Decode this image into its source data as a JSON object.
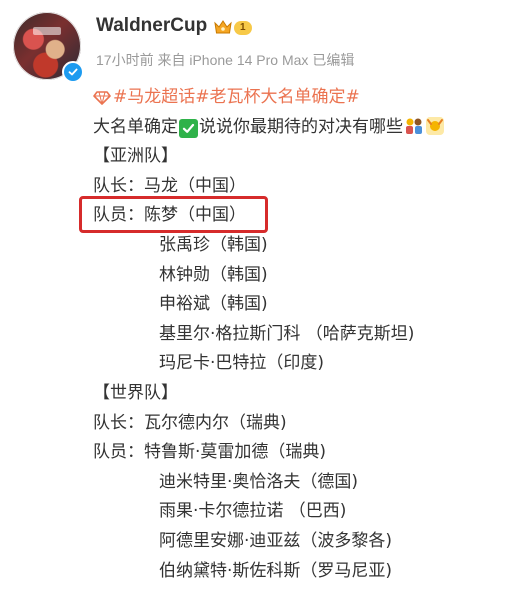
{
  "post": {
    "author": {
      "name": "WaldnerCup",
      "level": "1"
    },
    "meta": {
      "time": "17小时前",
      "source": "来自 iPhone 14 Pro Max",
      "edited": "已编辑"
    },
    "topic": "#马龙超话#老瓦杯大名单确定#",
    "intro_before": "大名单确定",
    "intro_after": "说说你最期待的对决有哪些",
    "lines": [
      {
        "text": "【亚洲队】",
        "kind": "team"
      },
      {
        "text": "队长：马龙（中国）",
        "kind": "row"
      },
      {
        "text": "队员：陈梦（中国）",
        "kind": "row",
        "highlighted": true
      },
      {
        "text": "张禹珍（韩国)",
        "kind": "member"
      },
      {
        "text": "林钟勋（韩国)",
        "kind": "member"
      },
      {
        "text": "申裕斌（韩国)",
        "kind": "member"
      },
      {
        "text": "基里尔·格拉斯门科 （哈萨克斯坦)",
        "kind": "member"
      },
      {
        "text": "玛尼卡·巴特拉（印度)",
        "kind": "member"
      },
      {
        "text": "【世界队】",
        "kind": "team"
      },
      {
        "text": "队长：瓦尔德内尔（瑞典)",
        "kind": "row"
      },
      {
        "text": "队员：特鲁斯·莫雷加德（瑞典)",
        "kind": "row"
      },
      {
        "text": "迪米特里·奥恰洛夫（德国)",
        "kind": "member"
      },
      {
        "text": "雨果·卡尔德拉诺 （巴西)",
        "kind": "member"
      },
      {
        "text": "阿德里安娜·迪亚兹（波多黎各)",
        "kind": "member"
      },
      {
        "text": "伯纳黛特·斯佐科斯（罗马尼亚)",
        "kind": "member"
      }
    ]
  },
  "colors": {
    "topic": "#eb7350",
    "highlight": "#d62b2b",
    "meta": "#9a9a9a",
    "verified": "#1d9bf0"
  },
  "icons": {
    "avatar": "avatar-photo",
    "verified": "verified-check-icon",
    "vip": "crown-icon",
    "topic": "diamond-icon",
    "check": "check-mark-emoji",
    "emoji1": "people-emoji",
    "emoji2": "cheering-emoji"
  }
}
